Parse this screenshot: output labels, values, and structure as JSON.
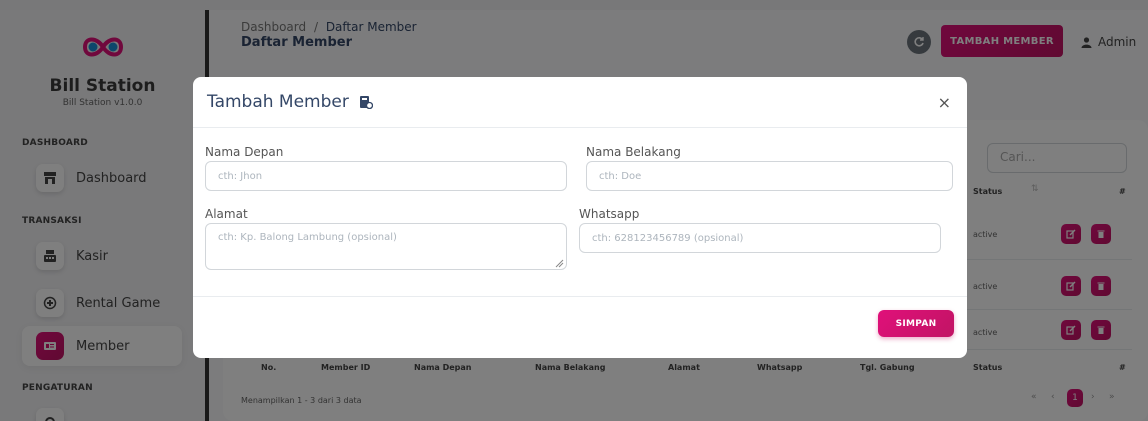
{
  "brand": {
    "title": "Bill Station",
    "subtitle": "Bill Station v1.0.0"
  },
  "sidebar": {
    "sections": [
      "DASHBOARD",
      "TRANSAKSI",
      "PENGATURAN"
    ],
    "items": [
      {
        "label": "Dashboard",
        "icon": "store-icon"
      },
      {
        "label": "Kasir",
        "icon": "cash-register-icon"
      },
      {
        "label": "Rental Game",
        "icon": "gamepad-icon"
      },
      {
        "label": "Member",
        "icon": "id-card-icon",
        "active": true
      }
    ]
  },
  "header": {
    "breadcrumb_root": "Dashboard",
    "breadcrumb_sep": "/",
    "breadcrumb_current": "Daftar Member",
    "title": "Daftar Member",
    "add_button": "TAMBAH MEMBER",
    "user": "Admin"
  },
  "table": {
    "search_placeholder": "Cari...",
    "status_header": "Status",
    "action_header": "#",
    "rows": [
      {
        "status": "active"
      },
      {
        "status": "active"
      },
      {
        "status": "active"
      }
    ],
    "footer_headers": [
      "No.",
      "Member ID",
      "Nama Depan",
      "Nama Belakang",
      "Alamat",
      "Whatsapp",
      "Tgl. Gabung",
      "Status",
      "#"
    ],
    "showing": "Menampilkan 1 - 3 dari 3 data",
    "pagination": {
      "first": "«",
      "prev": "‹",
      "current": "1",
      "next": "›",
      "last": "»"
    }
  },
  "modal": {
    "title": "Tambah Member",
    "close": "×",
    "fields": {
      "first_name": {
        "label": "Nama Depan",
        "placeholder": "cth: Jhon"
      },
      "last_name": {
        "label": "Nama Belakang",
        "placeholder": "cth: Doe"
      },
      "address": {
        "label": "Alamat",
        "placeholder": "cth: Kp. Balong Lambung (opsional)"
      },
      "whatsapp": {
        "label": "Whatsapp",
        "placeholder": "cth: 628123456789 (opsional)"
      }
    },
    "save_button": "SIMPAN"
  },
  "colors": {
    "accent": "#d6116f",
    "text": "#344767",
    "secondary": "#6c757d"
  }
}
